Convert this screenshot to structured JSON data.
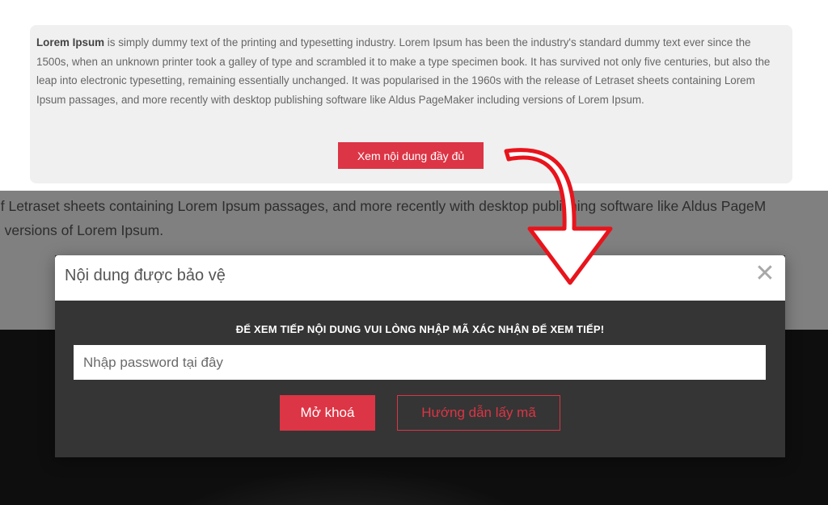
{
  "excerpt": {
    "bold_lead": "Lorem Ipsum",
    "body": " is simply dummy text of the printing and typesetting industry. Lorem Ipsum has been the industry's standard dummy text ever since the 1500s, when an unknown printer took a galley of type and scrambled it to make a type specimen book. It has survived not only five centuries, but also the leap into electronic typesetting, remaining essentially unchanged. It was popularised in the 1960s with the release of Letraset sheets containing Lorem Ipsum passages, and more recently with desktop publishing software like Aldus PageMaker including versions of Lorem Ipsum.",
    "read_more_label": "Xem nội dung đầy đủ"
  },
  "backdrop": {
    "line1": "of Letraset sheets containing Lorem Ipsum passages, and more recently with desktop publishing software like Aldus PageM",
    "line2": "g versions of Lorem Ipsum."
  },
  "modal": {
    "title": "Nội dung được bảo vệ",
    "close_symbol": "✕",
    "prompt": "ĐỂ XEM TIẾP NỘI DUNG VUI LÒNG NHẬP MÃ XÁC NHẬN ĐỂ XEM TIẾP!",
    "password_placeholder": "Nhập password tại đây",
    "password_value": "",
    "unlock_label": "Mở khoá",
    "guide_label": "Hướng dẫn lấy mã"
  },
  "colors": {
    "accent": "#dc3545",
    "modal_body": "#353535",
    "card_bg": "#f0f0f0",
    "arrow": "#e8141c"
  },
  "icons": {
    "close": "close-icon",
    "annotation": "curved-arrow-icon"
  }
}
